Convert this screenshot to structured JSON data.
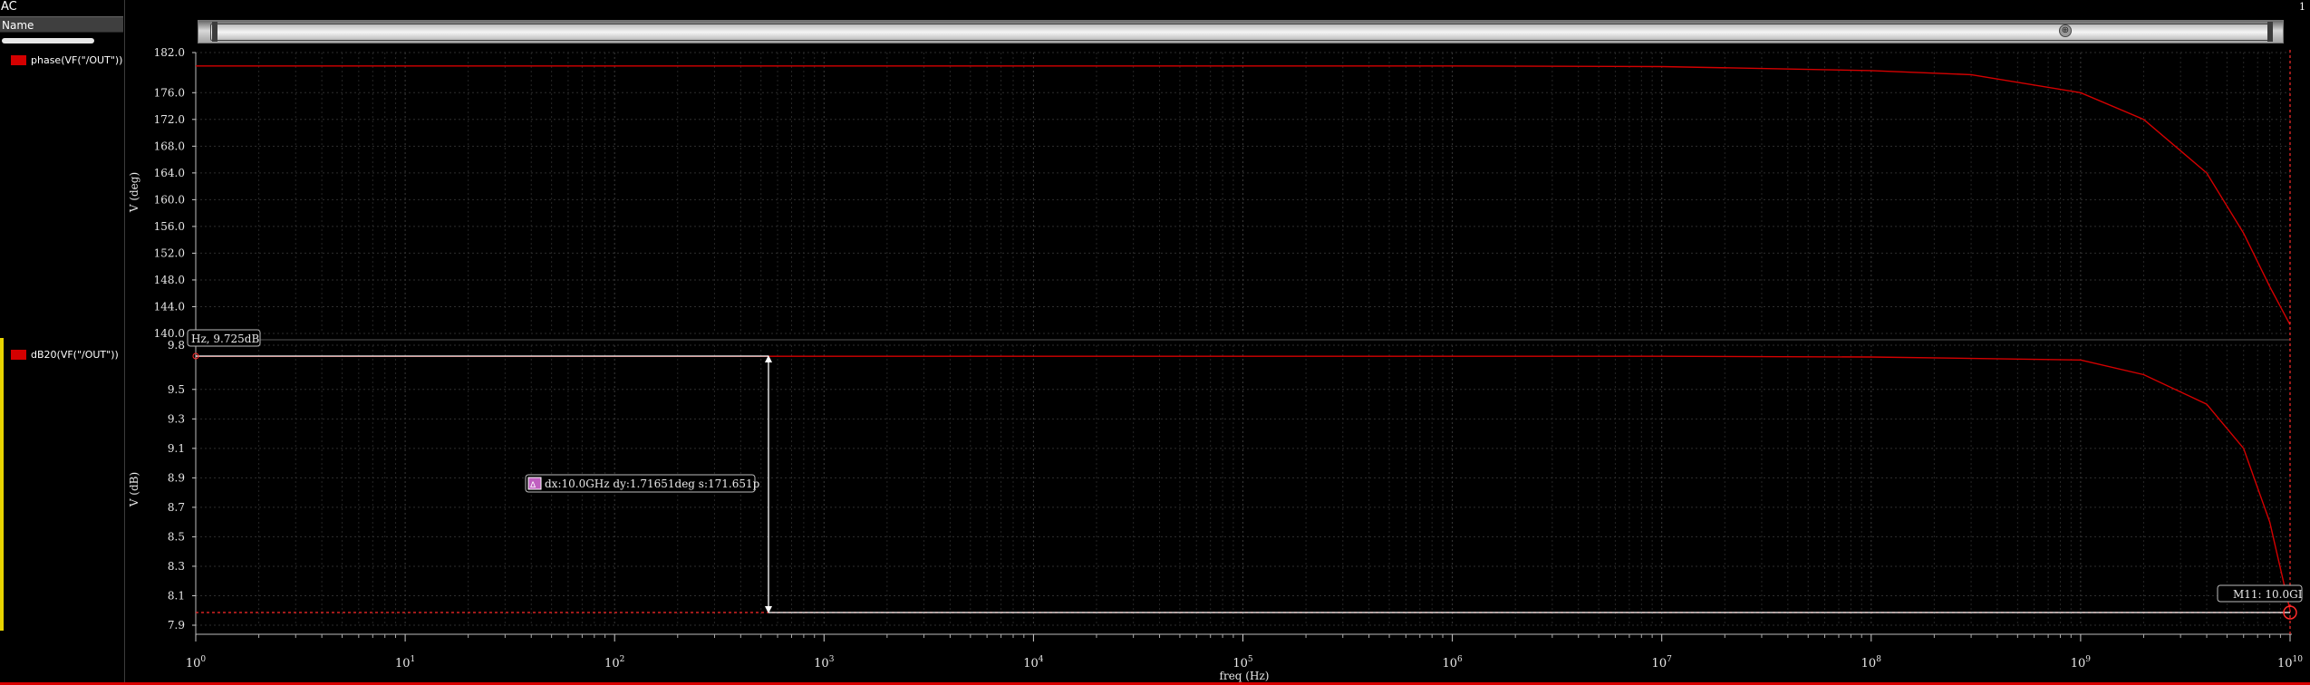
{
  "app": {
    "title": "AC",
    "page_number": "1"
  },
  "browser": {
    "column_header": "Name",
    "traces": [
      {
        "label": "phase(VF(\"/OUT\"))",
        "color": "#d40000"
      },
      {
        "label": "dB20(VF(\"/OUT\"))",
        "color": "#d40000"
      }
    ]
  },
  "zoom_bar": {
    "icon": "zoom-handle-icon"
  },
  "chart_data": {
    "type": "line",
    "xlabel": "freq (Hz)",
    "x_scale": "log",
    "xlim": [
      1,
      10000000000
    ],
    "x_tick_labels": [
      {
        "base": "10",
        "exp": "0"
      },
      {
        "base": "10",
        "exp": "1"
      },
      {
        "base": "10",
        "exp": "2"
      },
      {
        "base": "10",
        "exp": "3"
      },
      {
        "base": "10",
        "exp": "4"
      },
      {
        "base": "10",
        "exp": "5"
      },
      {
        "base": "10",
        "exp": "6"
      },
      {
        "base": "10",
        "exp": "7"
      },
      {
        "base": "10",
        "exp": "8"
      },
      {
        "base": "10",
        "exp": "9"
      },
      {
        "base": "10",
        "exp": "10"
      }
    ],
    "grid": true,
    "colors": {
      "trace": "#d40000",
      "marker_line": "#ff2b2b",
      "annotation": "#ffffff"
    },
    "subplots": [
      {
        "ylabel": "V (deg)",
        "ylim": [
          140.0,
          182.0
        ],
        "y_ticks": [
          "140.0",
          "144.0",
          "148.0",
          "152.0",
          "156.0",
          "160.0",
          "164.0",
          "168.0",
          "172.0",
          "176.0",
          "182.0"
        ],
        "series": [
          {
            "name": "phase(VF(\"/OUT\"))",
            "x": [
              1,
              10,
              100,
              1000,
              10000,
              100000,
              1000000,
              10000000,
              100000000,
              300000000,
              1000000000,
              2000000000,
              4000000000,
              6000000000,
              8000000000,
              10000000000
            ],
            "y": [
              180.0,
              180.0,
              180.0,
              180.0,
              180.0,
              180.0,
              180.0,
              179.9,
              179.3,
              178.7,
              176.0,
              172.0,
              164.0,
              155.0,
              147.0,
              141.3
            ]
          }
        ]
      },
      {
        "ylabel": "V (dB)",
        "ylim": [
          7.9,
          9.8
        ],
        "y_ticks": [
          "7.9",
          "8.1",
          "8.3",
          "8.5",
          "8.7",
          "8.9",
          "9.1",
          "9.3",
          "9.5",
          "9.8"
        ],
        "series": [
          {
            "name": "dB20(VF(\"/OUT\"))",
            "x": [
              1,
              10,
              100,
              1000,
              10000,
              100000,
              1000000,
              10000000,
              100000000,
              1000000000,
              2000000000,
              4000000000,
              6000000000,
              8000000000,
              10000000000
            ],
            "y": [
              9.725,
              9.725,
              9.725,
              9.725,
              9.725,
              9.725,
              9.725,
              9.725,
              9.72,
              9.7,
              9.6,
              9.4,
              9.1,
              8.6,
              8.0
            ]
          }
        ]
      }
    ],
    "markers": {
      "left_label": "Hz, 9.725dB",
      "right_label": "M11: 10.0GI",
      "left_level_db": 9.725,
      "right_level_db": 8.01,
      "delta_label": "dx:10.0GHz dy:1.71651deg s:171.651p",
      "delta_icon": "delta-marker-icon"
    }
  }
}
